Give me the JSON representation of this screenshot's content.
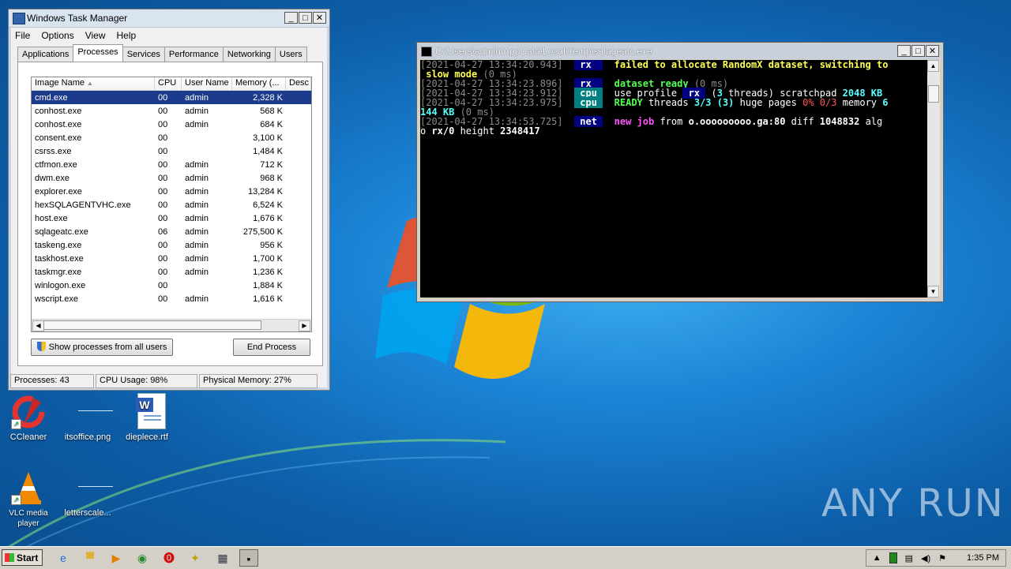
{
  "task_manager": {
    "title": "Windows Task Manager",
    "menu": [
      "File",
      "Options",
      "View",
      "Help"
    ],
    "tabs": [
      "Applications",
      "Processes",
      "Services",
      "Performance",
      "Networking",
      "Users"
    ],
    "active_tab": "Processes",
    "columns": [
      "Image Name",
      "CPU",
      "User Name",
      "Memory (...",
      "Desc"
    ],
    "rows": [
      {
        "name": "cmd.exe",
        "cpu": "00",
        "user": "admin",
        "memory": "2,328 K",
        "selected": true
      },
      {
        "name": "conhost.exe",
        "cpu": "00",
        "user": "admin",
        "memory": "568 K"
      },
      {
        "name": "conhost.exe",
        "cpu": "00",
        "user": "admin",
        "memory": "684 K"
      },
      {
        "name": "consent.exe",
        "cpu": "00",
        "user": "",
        "memory": "3,100 K"
      },
      {
        "name": "csrss.exe",
        "cpu": "00",
        "user": "",
        "memory": "1,484 K"
      },
      {
        "name": "ctfmon.exe",
        "cpu": "00",
        "user": "admin",
        "memory": "712 K"
      },
      {
        "name": "dwm.exe",
        "cpu": "00",
        "user": "admin",
        "memory": "968 K"
      },
      {
        "name": "explorer.exe",
        "cpu": "00",
        "user": "admin",
        "memory": "13,284 K"
      },
      {
        "name": "hexSQLAGENTVHC.exe",
        "cpu": "00",
        "user": "admin",
        "memory": "6,524 K"
      },
      {
        "name": "host.exe",
        "cpu": "00",
        "user": "admin",
        "memory": "1,676 K"
      },
      {
        "name": "sqlageatc.exe",
        "cpu": "06",
        "user": "admin",
        "memory": "275,500 K"
      },
      {
        "name": "taskeng.exe",
        "cpu": "00",
        "user": "admin",
        "memory": "956 K"
      },
      {
        "name": "taskhost.exe",
        "cpu": "00",
        "user": "admin",
        "memory": "1,700 K"
      },
      {
        "name": "taskmgr.exe",
        "cpu": "00",
        "user": "admin",
        "memory": "1,236 K"
      },
      {
        "name": "winlogon.exe",
        "cpu": "00",
        "user": "",
        "memory": "1,884 K"
      },
      {
        "name": "wscript.exe",
        "cpu": "00",
        "user": "admin",
        "memory": "1,616 K"
      }
    ],
    "show_all_button": "Show processes from all users",
    "end_process_button": "End Process",
    "status": {
      "processes": "Processes: 43",
      "cpu": "CPU Usage: 98%",
      "memory": "Physical Memory: 27%"
    }
  },
  "console": {
    "title": "C:\\Users\\admin\\AppData\\Local\\Temp\\sqlageatc.exe",
    "lines": [
      [
        [
          "[2021-04-27 13:34:20.943]",
          "g"
        ],
        [
          "  ",
          ""
        ],
        [
          " rx  ",
          "tagb"
        ],
        [
          "  ",
          ""
        ],
        [
          "failed to allocate RandomX dataset, switching to",
          "y"
        ]
      ],
      [
        [
          " slow mode ",
          "y"
        ],
        [
          "(0 ms)",
          "g"
        ]
      ],
      [
        [
          "[2021-04-27 13:34:23.896]",
          "g"
        ],
        [
          "  ",
          ""
        ],
        [
          " rx  ",
          "tagb"
        ],
        [
          "  ",
          ""
        ],
        [
          "dataset ready ",
          "G"
        ],
        [
          "(0 ms)",
          "g"
        ]
      ],
      [
        [
          "[2021-04-27 13:34:23.912]",
          "g"
        ],
        [
          "  ",
          ""
        ],
        [
          " cpu ",
          "tagc"
        ],
        [
          "  ",
          ""
        ],
        [
          "use profile ",
          "w"
        ],
        [
          " rx ",
          "tagb"
        ],
        [
          " (",
          "w"
        ],
        [
          "3",
          "c"
        ],
        [
          " threads) scratchpad ",
          "w"
        ],
        [
          "2048 KB",
          "c"
        ]
      ],
      [
        [
          "[2021-04-27 13:34:23.975]",
          "g"
        ],
        [
          "  ",
          ""
        ],
        [
          " cpu ",
          "tagc"
        ],
        [
          "  ",
          ""
        ],
        [
          "READY",
          "G"
        ],
        [
          " threads ",
          "w"
        ],
        [
          "3/3 (3)",
          "c"
        ],
        [
          " huge pages ",
          "w"
        ],
        [
          "0% 0/3",
          "r"
        ],
        [
          " memory ",
          "w"
        ],
        [
          "6",
          "c"
        ]
      ],
      [
        [
          "144 KB",
          "c"
        ],
        [
          " (0 ms)",
          "g"
        ]
      ],
      [
        [
          "[2021-04-27 13:34:53.725]",
          "g"
        ],
        [
          "  ",
          ""
        ],
        [
          " net ",
          "tagb"
        ],
        [
          "  ",
          ""
        ],
        [
          "new job",
          "m"
        ],
        [
          " from ",
          "w"
        ],
        [
          "o.ooooooooo.ga:80",
          "b"
        ],
        [
          " diff ",
          "w"
        ],
        [
          "1048832",
          "b"
        ],
        [
          " alg",
          "w"
        ]
      ],
      [
        [
          "o ",
          "w"
        ],
        [
          "rx/0",
          "b"
        ],
        [
          " height ",
          "w"
        ],
        [
          "2348417",
          "b"
        ]
      ]
    ]
  },
  "desktop_icons": [
    {
      "label": "CCleaner",
      "icon": "ccleaner-icon"
    },
    {
      "label": "itsoffice.png",
      "icon": "image-file-icon"
    },
    {
      "label": "dieplece.rtf",
      "icon": "word-document-icon"
    },
    {
      "label": "VLC media player",
      "icon": "vlc-icon"
    },
    {
      "label": "letterscale...",
      "icon": "image-file-icon"
    }
  ],
  "watermark": "ANY RUN",
  "taskbar": {
    "start_label": "Start",
    "clock": "1:35 PM"
  },
  "colors": {
    "selection": "#1d3b8d",
    "desktop_blue": "#1b84d6",
    "console_bg": "#000000"
  }
}
